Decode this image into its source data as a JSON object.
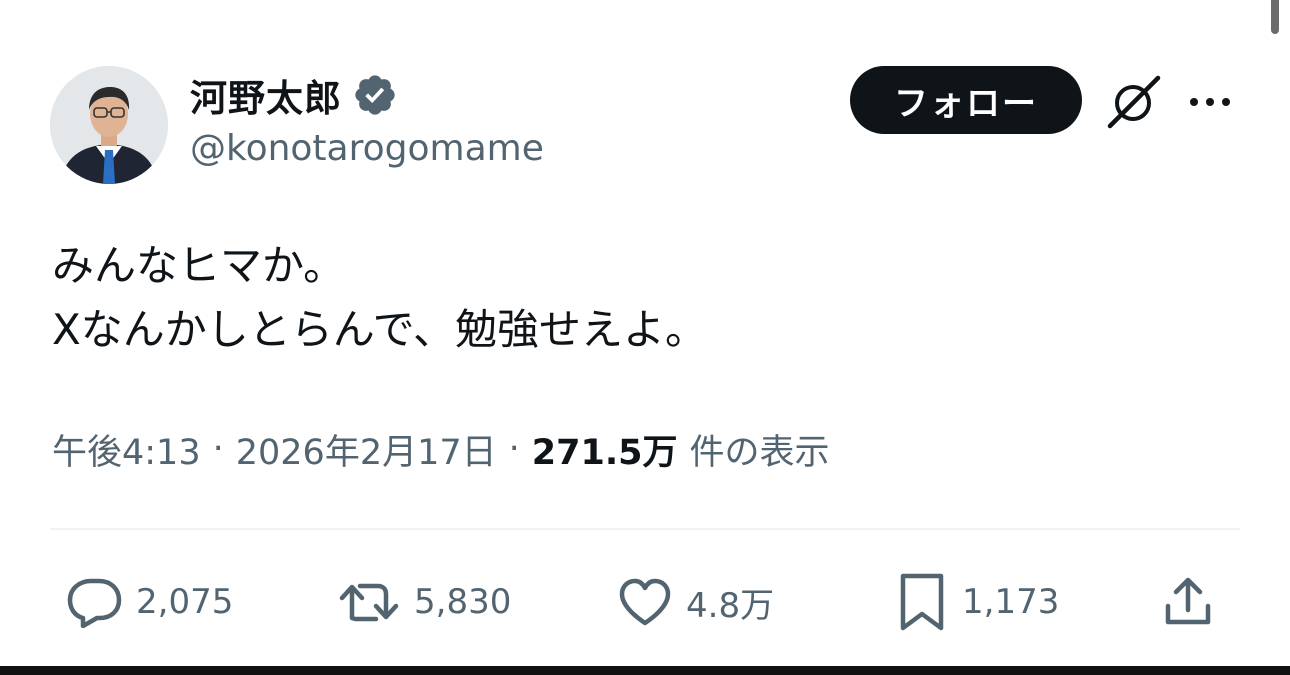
{
  "author": {
    "display_name": "河野太郎",
    "handle": "@konotarogomame",
    "verified": true,
    "verified_color": "#536471"
  },
  "header": {
    "follow_label": "フォロー",
    "grok_icon": "grok-icon",
    "more_icon": "more-horizontal-icon"
  },
  "tweet": {
    "line1": "みんなヒマか。",
    "line2": "Xなんかしとらんで、勉強せえよ。"
  },
  "meta": {
    "time": "午後4:13",
    "separator1": "·",
    "date": "2026年2月17日",
    "separator2": "·",
    "views_count": "271.5万",
    "views_label": "件の表示"
  },
  "actions": {
    "replies": "2,075",
    "retweets": "5,830",
    "likes": "4.8万",
    "bookmarks": "1,173"
  },
  "colors": {
    "text_primary": "#0f1419",
    "text_secondary": "#536471",
    "divider": "#eff3f4",
    "follow_bg": "#0f1419"
  }
}
